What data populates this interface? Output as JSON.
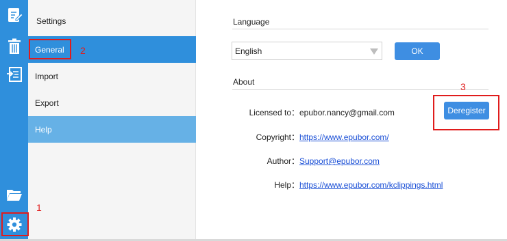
{
  "sidebar": {
    "icons": [
      "edit-icon",
      "trash-icon",
      "import-icon",
      "folder-icon",
      "gear-icon"
    ],
    "accent_color": "#2f8fdc"
  },
  "settings": {
    "title": "Settings",
    "items": [
      {
        "label": "General",
        "state": "active"
      },
      {
        "label": "Import",
        "state": "normal"
      },
      {
        "label": "Export",
        "state": "normal"
      },
      {
        "label": "Help",
        "state": "highlighted"
      }
    ]
  },
  "language": {
    "section_title": "Language",
    "selected": "English",
    "ok_label": "OK"
  },
  "about": {
    "section_title": "About",
    "rows": [
      {
        "label": "Licensed to：",
        "value": "epubor.nancy@gmail.com",
        "link": false
      },
      {
        "label": "Copyright：",
        "value": "https://www.epubor.com/",
        "link": true
      },
      {
        "label": "Author：",
        "value": "Support@epubor.com",
        "link": true
      },
      {
        "label": "Help：",
        "value": "https://www.epubor.com/kclippings.html",
        "link": true
      }
    ],
    "deregister_label": "Deregister"
  },
  "annotations": {
    "step1": "1",
    "step2": "2",
    "step3": "3",
    "color": "#e01c1c"
  }
}
